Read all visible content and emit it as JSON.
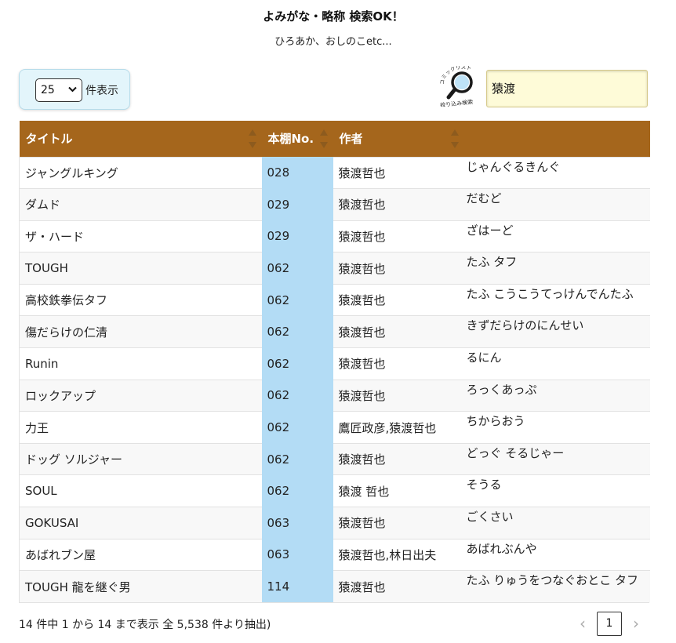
{
  "header": {
    "title": "よみがな・略称 検索OK！",
    "subtitle": "ひろあか、おしのこetc..."
  },
  "length": {
    "selected": "25",
    "label": "件表示"
  },
  "search": {
    "logo_text": "コミックリスト 絞り込み検索",
    "value": "猿渡"
  },
  "table": {
    "columns": [
      "タイトル",
      "本棚No.",
      "作者",
      ""
    ],
    "rows": [
      {
        "title": "ジャングルキング",
        "shelf": "028",
        "author": "猿渡哲也",
        "reading": "じゃんぐるきんぐ"
      },
      {
        "title": "ダムド",
        "shelf": "029",
        "author": "猿渡哲也",
        "reading": "だむど"
      },
      {
        "title": "ザ・ハード",
        "shelf": "029",
        "author": "猿渡哲也",
        "reading": "ざはーど"
      },
      {
        "title": "TOUGH",
        "shelf": "062",
        "author": "猿渡哲也",
        "reading": "たふ タフ"
      },
      {
        "title": "高校鉄拳伝タフ",
        "shelf": "062",
        "author": "猿渡哲也",
        "reading": "たふ こうこうてっけんでんたふ"
      },
      {
        "title": "傷だらけの仁清",
        "shelf": "062",
        "author": "猿渡哲也",
        "reading": "きずだらけのにんせい"
      },
      {
        "title": "Runin",
        "shelf": "062",
        "author": "猿渡哲也",
        "reading": "るにん"
      },
      {
        "title": "ロックアップ",
        "shelf": "062",
        "author": "猿渡哲也",
        "reading": "ろっくあっぷ"
      },
      {
        "title": "力王",
        "shelf": "062",
        "author": "鷹匠政彦,猿渡哲也",
        "reading": "ちからおう"
      },
      {
        "title": "ドッグ ソルジャー",
        "shelf": "062",
        "author": "猿渡哲也",
        "reading": "どっぐ そるじゃー"
      },
      {
        "title": "SOUL",
        "shelf": "062",
        "author": "猿渡 哲也",
        "reading": "そうる"
      },
      {
        "title": "GOKUSAI",
        "shelf": "063",
        "author": "猿渡哲也",
        "reading": "ごくさい"
      },
      {
        "title": "あばれブン屋",
        "shelf": "063",
        "author": "猿渡哲也,林日出夫",
        "reading": "あばれぶんや"
      },
      {
        "title": "TOUGH 龍を継ぐ男",
        "shelf": "114",
        "author": "猿渡哲也",
        "reading": "たふ りゅうをつなぐおとこ タフ"
      }
    ]
  },
  "info": {
    "text": "14 件中 1 から 14 まで表示 全 5,538 件より抽出)"
  },
  "pagination": {
    "prev": "‹",
    "current": "1",
    "next": "›"
  }
}
